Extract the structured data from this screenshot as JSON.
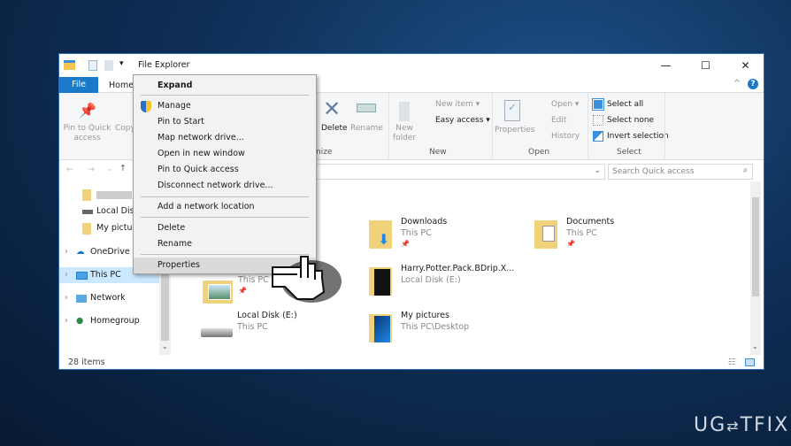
{
  "window": {
    "title": "File Explorer",
    "minimize": "—",
    "maximize": "☐",
    "close": "✕",
    "help": "?",
    "collapse": "^"
  },
  "tabs": {
    "file": "File",
    "home": "Home"
  },
  "ribbon": {
    "pin_quick_access": "Pin to Quick access",
    "copy": "Copy",
    "delete": "Delete",
    "rename": "Rename",
    "organize": "nize",
    "new_folder": "New folder",
    "new_item": "New item ▾",
    "easy_access": "Easy access ▾",
    "new_group": "New",
    "properties": "Properties",
    "open": "Open ▾",
    "edit": "Edit",
    "history": "History",
    "open_group": "Open",
    "select_all": "Select all",
    "select_none": "Select none",
    "invert_selection": "Invert selection",
    "select_group": "Select"
  },
  "address": {
    "search_placeholder": "Search Quick access"
  },
  "nav": {
    "items": [
      {
        "label": ""
      },
      {
        "label": "Local Disk"
      },
      {
        "label": "My pictur"
      },
      {
        "label": "OneDrive"
      },
      {
        "label": "This PC"
      },
      {
        "label": "Network"
      },
      {
        "label": "Homegroup"
      }
    ]
  },
  "context_menu": {
    "items": [
      "Expand",
      "Manage",
      "Pin to Start",
      "Map network drive...",
      "Open in new window",
      "Pin to Quick access",
      "Disconnect network drive...",
      "Add a network location",
      "Delete",
      "Rename",
      "Properties"
    ],
    "highlighted": "Properties"
  },
  "content": {
    "tiles": [
      {
        "title": "Downloads",
        "sub": "This PC"
      },
      {
        "title": "Documents",
        "sub": "This PC"
      },
      {
        "title": "",
        "sub": "This PC"
      },
      {
        "title": "Harry.Potter.Pack.BDrip.X...",
        "sub": "Local Disk (E:)"
      },
      {
        "title": "Local Disk (E:)",
        "sub": "This PC"
      },
      {
        "title": "My pictures",
        "sub": "This PC\\Desktop"
      }
    ]
  },
  "status": {
    "items": "28 items"
  },
  "watermark": "UG⇄TFIX",
  "colors": {
    "accent": "#1979ca",
    "folder": "#f0d27a",
    "menu_highlight": "#dadada"
  }
}
